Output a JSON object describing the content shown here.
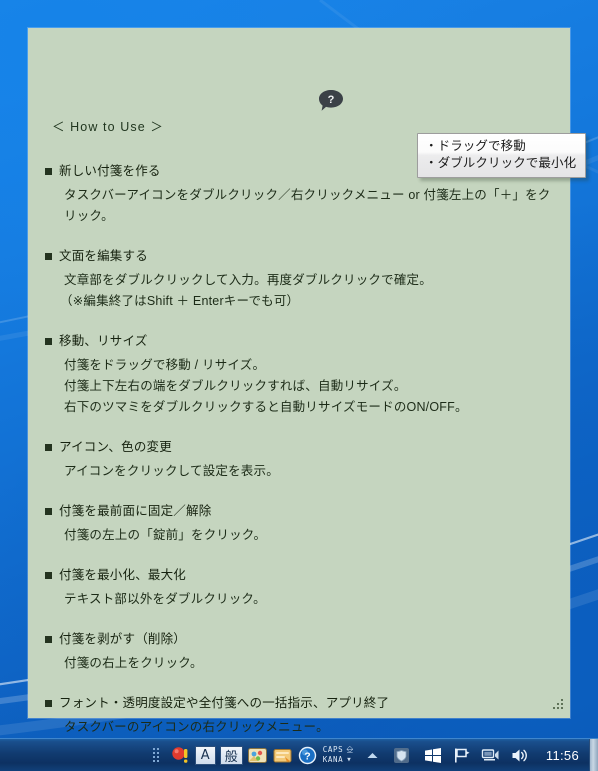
{
  "window": {
    "type": "sticky-note",
    "background_color": "#c5d5bf",
    "help_icon": "help-speech-bubble-icon",
    "help_glyph": "?",
    "resize_grip": "resize-grip"
  },
  "tooltip": {
    "lines": [
      "・ドラッグで移動",
      "・ダブルクリックで最小化"
    ]
  },
  "note": {
    "title": "＜ How to Use ＞",
    "sections": [
      {
        "heading": "新しい付箋を作る",
        "lines": [
          "タスクバーアイコンをダブルクリック／右クリックメニュー or 付箋左上の「＋」をクリック。"
        ]
      },
      {
        "heading": "文面を編集する",
        "lines": [
          "文章部をダブルクリックして入力。再度ダブルクリックで確定。",
          "（※編集終了はShift ＋ Enterキーでも可）"
        ]
      },
      {
        "heading": "移動、リサイズ",
        "lines": [
          "付箋をドラッグで移動 / リサイズ。",
          "付箋上下左右の端をダブルクリックすれば、自動リサイズ。",
          "右下のツマミをダブルクリックすると自動リサイズモードのON/OFF。"
        ]
      },
      {
        "heading": "アイコン、色の変更",
        "lines": [
          "アイコンをクリックして設定を表示。"
        ]
      },
      {
        "heading": "付箋を最前面に固定／解除",
        "lines": [
          "付箋の左上の「錠前」をクリック。"
        ]
      },
      {
        "heading": "付箋を最小化、最大化",
        "lines": [
          "テキスト部以外をダブルクリック。"
        ]
      },
      {
        "heading": "付箋を剥がす（削除）",
        "lines": [
          "付箋の右上をクリック。"
        ]
      },
      {
        "heading": "フォント・透明度設定や全付箋への一括指示、アプリ終了",
        "lines": [
          "タスクバーのアイコンの右クリックメニュー。"
        ]
      }
    ]
  },
  "taskbar": {
    "tray": {
      "ime_alpha": "A",
      "ime_mode": "般",
      "caps_label": "CAPS",
      "kana_label": "KANA",
      "icons": [
        "notification-alert-icon",
        "ime-input-mode-icon",
        "ime-conversion-mode-icon",
        "ime-tool-palette-icon",
        "ime-dictionary-icon",
        "ime-help-icon",
        "ime-options-icon",
        "show-hidden-icons-icon",
        "security-shield-icon",
        "windows-logo-icon",
        "flag-action-center-icon",
        "network-icon",
        "volume-icon"
      ]
    },
    "clock": "11:56",
    "show_desktop_button": "show-desktop-button"
  }
}
